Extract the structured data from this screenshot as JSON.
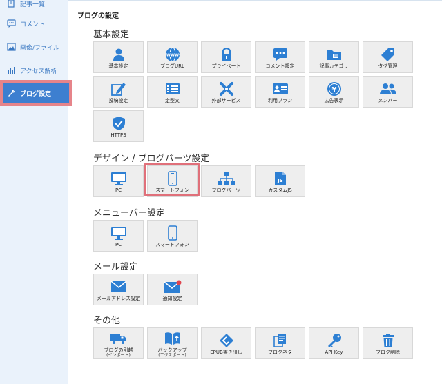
{
  "colors": {
    "accent": "#3d7fd0",
    "highlight": "#e0707a",
    "sidebar_bg": "#eaf2fb",
    "tile_bg": "#eeeeee",
    "icon_blue": "#2d7fd3"
  },
  "sidebar": {
    "items": [
      {
        "label": "記事一覧",
        "icon": "document-icon"
      },
      {
        "label": "コメント",
        "icon": "comment-icon"
      },
      {
        "label": "画像/ファイル",
        "icon": "image-icon"
      },
      {
        "label": "アクセス解析",
        "icon": "bar-chart-icon"
      },
      {
        "label": "ブログ設定",
        "icon": "wrench-icon",
        "active": true
      }
    ]
  },
  "page_title": "ブログの設定",
  "sections": {
    "basic": {
      "title": "基本設定",
      "tiles": [
        {
          "label": "基本設定",
          "icon": "user-icon"
        },
        {
          "label": "ブログURL",
          "icon": "www-globe-icon"
        },
        {
          "label": "プライベート",
          "icon": "lock-icon"
        },
        {
          "label": "コメント設定",
          "icon": "comment-icon"
        },
        {
          "label": "記事カテゴリ",
          "icon": "folder-icon"
        },
        {
          "label": "タグ管理",
          "icon": "tag-icon"
        },
        {
          "label": "投稿設定",
          "icon": "pencil-icon"
        },
        {
          "label": "定型文",
          "icon": "list-icon"
        },
        {
          "label": "外部サービス",
          "icon": "tools-icon"
        },
        {
          "label": "利用プラン",
          "icon": "id-card-icon"
        },
        {
          "label": "広告表示",
          "icon": "yen-coin-icon"
        },
        {
          "label": "メンバー",
          "icon": "users-icon"
        },
        {
          "label": "HTTPS",
          "icon": "shield-check-icon"
        }
      ]
    },
    "design": {
      "title": "デザイン / ブログパーツ設定",
      "tiles": [
        {
          "label": "PC",
          "icon": "monitor-icon"
        },
        {
          "label": "スマートフォン",
          "icon": "smartphone-icon"
        },
        {
          "label": "ブログパーツ",
          "icon": "sitemap-icon"
        },
        {
          "label": "カスタムJS",
          "icon": "js-file-icon"
        }
      ]
    },
    "menubar": {
      "title": "メニューバー設定",
      "tiles": [
        {
          "label": "PC",
          "icon": "monitor-icon"
        },
        {
          "label": "スマートフォン",
          "icon": "smartphone-icon"
        }
      ]
    },
    "mail": {
      "title": "メール設定",
      "tiles": [
        {
          "label": "メールアドレス設定",
          "icon": "mail-icon"
        },
        {
          "label": "通知設定",
          "icon": "mail-notify-icon"
        }
      ]
    },
    "other": {
      "title": "その他",
      "tiles": [
        {
          "label": "ブログの引越",
          "sub": "(インポート)",
          "icon": "truck-icon"
        },
        {
          "label": "バックアップ",
          "sub": "(エクスポート)",
          "icon": "book-upload-icon"
        },
        {
          "label": "EPUB書き出し",
          "icon": "epub-icon"
        },
        {
          "label": "ブログネタ",
          "icon": "copy-icon"
        },
        {
          "label": "API Key",
          "icon": "key-icon"
        },
        {
          "label": "ブログ削除",
          "icon": "trash-icon"
        }
      ]
    }
  }
}
